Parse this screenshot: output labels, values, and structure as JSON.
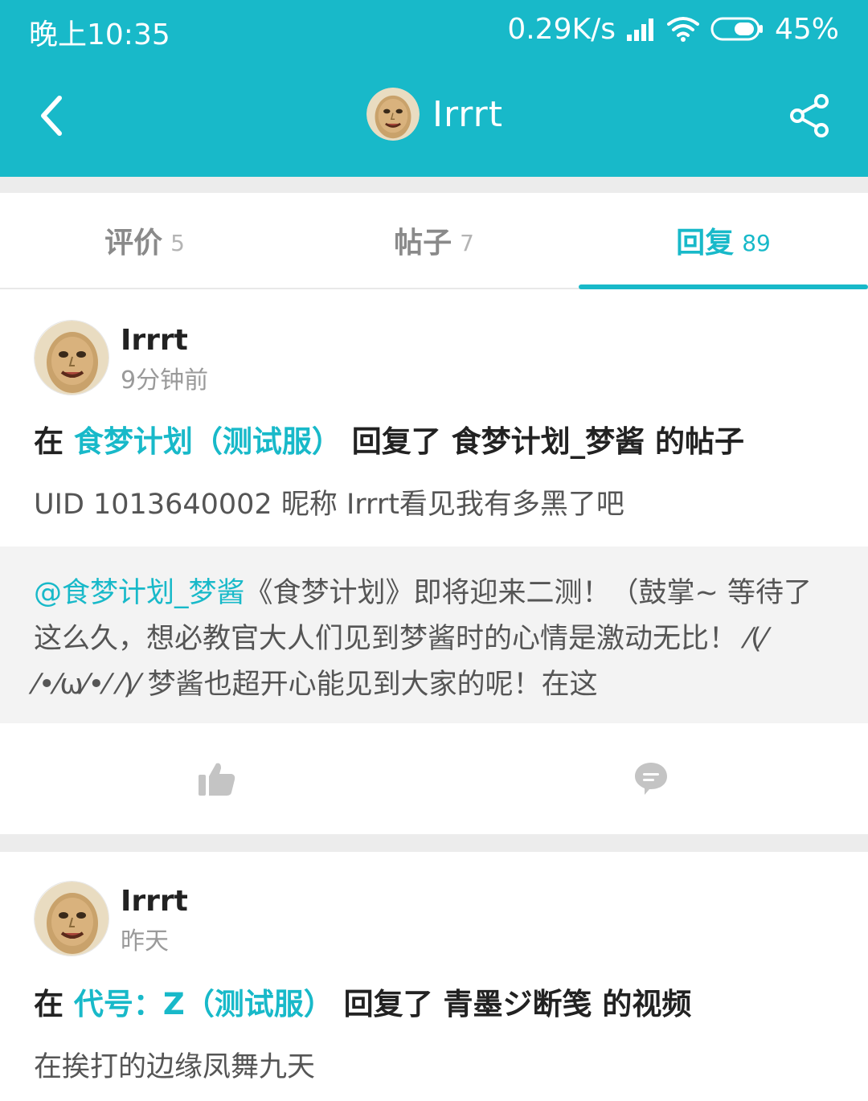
{
  "status_bar": {
    "time": "晚上10:35",
    "network_speed": "0.29K/s",
    "battery": "45%",
    "icons": [
      "signal-icon",
      "wifi-icon",
      "battery-icon"
    ]
  },
  "nav": {
    "title": "Irrrt",
    "back_icon": "chevron-left-icon",
    "share_icon": "share-icon"
  },
  "tabs": [
    {
      "label": "评价",
      "count": "5",
      "active": false
    },
    {
      "label": "帖子",
      "count": "7",
      "active": false
    },
    {
      "label": "回复",
      "count": "89",
      "active": true
    }
  ],
  "posts": [
    {
      "user": "Irrrt",
      "time": "9分钟前",
      "action": {
        "prefix": "在 ",
        "link": "食梦计划（测试服）",
        "middle": " 回复了 ",
        "target": "食梦计划_梦酱",
        "suffix": " 的帖子"
      },
      "reply": "UID 1013640002 昵称 Irrrt看见我有多黑了吧",
      "quote": {
        "mention": "@食梦计划_梦酱",
        "text": "《食梦计划》即将迎来二测！（鼓掌~ 等待了这么久，想必教官大人们见到梦酱时的心情是激动无比！ ⁄(⁄ ⁄•⁄ω⁄•⁄ ⁄)⁄  梦酱也超开心能见到大家的呢！在这"
      },
      "like_icon": "thumbs-up-icon",
      "comment_icon": "comment-icon"
    },
    {
      "user": "Irrrt",
      "time": "昨天",
      "action": {
        "prefix": "在 ",
        "link": "代号：Z（测试服）",
        "middle": " 回复了 ",
        "target": "青墨ジ断笺",
        "suffix": " 的视频"
      },
      "reply": "在挨打的边缘凤舞九天"
    }
  ],
  "colors": {
    "accent": "#18b9c9",
    "text_dark": "#222222",
    "text_grey": "#9a9a9a",
    "quote_bg": "#f3f3f3"
  }
}
